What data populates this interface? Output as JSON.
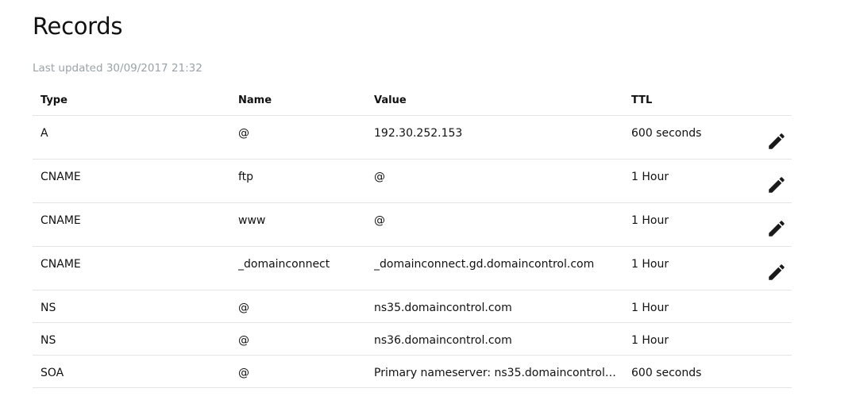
{
  "page": {
    "title": "Records",
    "last_updated": "Last updated 30/09/2017 21:32"
  },
  "table": {
    "columns": [
      "Type",
      "Name",
      "Value",
      "TTL"
    ],
    "rows": [
      {
        "type": "A",
        "name": "@",
        "value": "192.30.252.153",
        "ttl": "600 seconds",
        "editable": true
      },
      {
        "type": "CNAME",
        "name": "ftp",
        "value": "@",
        "ttl": "1 Hour",
        "editable": true
      },
      {
        "type": "CNAME",
        "name": "www",
        "value": "@",
        "ttl": "1 Hour",
        "editable": true
      },
      {
        "type": "CNAME",
        "name": "_domainconnect",
        "value": "_domainconnect.gd.domaincontrol.com",
        "ttl": "1 Hour",
        "editable": true
      },
      {
        "type": "NS",
        "name": "@",
        "value": "ns35.domaincontrol.com",
        "ttl": "1 Hour",
        "editable": false
      },
      {
        "type": "NS",
        "name": "@",
        "value": "ns36.domaincontrol.com",
        "ttl": "1 Hour",
        "editable": false
      },
      {
        "type": "SOA",
        "name": "@",
        "value": "Primary nameserver: ns35.domaincontrol.co...",
        "ttl": "600 seconds",
        "editable": false
      }
    ],
    "edit_icon": "pencil-icon"
  }
}
